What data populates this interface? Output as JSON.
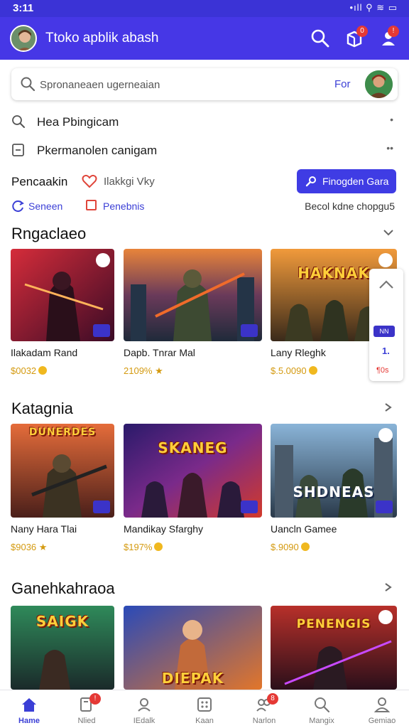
{
  "status_bar": {
    "time": "3:11",
    "indicators": "•ıll ⚲ ≋ ▭"
  },
  "app_bar": {
    "title": "Ttoko apblik abash",
    "cart_badge": "0",
    "profile_badge": "!"
  },
  "search": {
    "placeholder": "Spronaneaen ugerneaian",
    "action": "For"
  },
  "recent_searches": [
    {
      "text": "Hea Pbingicam",
      "icon": "search-icon",
      "marker": "•"
    },
    {
      "text": "Pkermanolen canigam",
      "icon": "tablet-icon",
      "marker": "••"
    }
  ],
  "filters": {
    "label": "Pencaakin",
    "favorites_label": "Ilakkgi Vky",
    "button_label": "Finogden Gara"
  },
  "sub_filters": {
    "first": "Seneen",
    "second": "Penebnis",
    "sort": "Becol kdne chopgu5"
  },
  "sections": [
    {
      "title": "Rngaclaeo",
      "games": [
        {
          "name": "Ilakadam Rand",
          "price": "$0032",
          "price_icon": "coin-icon"
        },
        {
          "name": "Dapb. Tnrar Mal",
          "price": "2109%",
          "price_icon": "star-icon"
        },
        {
          "name": "Lany Rleghk",
          "price": "$.5.0090",
          "price_icon": "coin-icon",
          "caption": "HAKNAK"
        }
      ]
    },
    {
      "title": "Katagnia",
      "games": [
        {
          "name": "Nany Hara Tlai",
          "price": "$9036",
          "price_icon": "star-icon",
          "caption": "DUNERDES"
        },
        {
          "name": "Mandikay Sfarghy",
          "price": "$197%",
          "price_icon": "coin-icon",
          "caption": "SKANEG"
        },
        {
          "name": "Uancln Gamee",
          "price": "$.9090",
          "price_icon": "coin-icon",
          "caption": "SHDNEAS"
        }
      ]
    },
    {
      "title": "Ganehkahraoa",
      "games": [
        {
          "caption": "SAIGK"
        },
        {
          "caption": "DIEPAK"
        },
        {
          "caption": "PENENGIS"
        }
      ]
    }
  ],
  "float_panel": {
    "badge": "NN",
    "count": "1.",
    "extra": "¶0s"
  },
  "bottom_nav": [
    {
      "label": "Hame",
      "icon": "home-icon",
      "active": true
    },
    {
      "label": "Nlied",
      "icon": "library-icon",
      "badge": "!"
    },
    {
      "label": "IEdalk",
      "icon": "profile-card-icon"
    },
    {
      "label": "Kaan",
      "icon": "apps-icon"
    },
    {
      "label": "Narlon",
      "icon": "friends-icon",
      "badge": "8"
    },
    {
      "label": "Mangix",
      "icon": "search-icon"
    },
    {
      "label": "Gemiao",
      "icon": "user-icon"
    }
  ],
  "colors": {
    "primary": "#4637e6",
    "accent": "#3f3ce4",
    "price": "#d49a10",
    "badge": "#e53935"
  }
}
